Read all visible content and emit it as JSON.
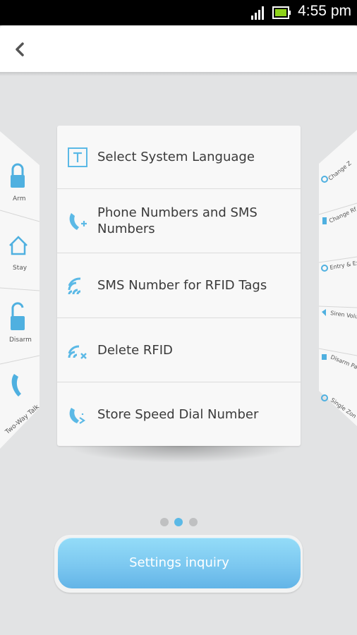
{
  "status_bar": {
    "time": "4:55 pm"
  },
  "left_panel": {
    "items": [
      {
        "label": "Arm",
        "icon": "lock-closed-icon"
      },
      {
        "label": "Stay",
        "icon": "home-icon"
      },
      {
        "label": "Disarm",
        "icon": "lock-open-icon"
      },
      {
        "label": "Two-Way Talk",
        "icon": "phone-icon"
      }
    ]
  },
  "right_panel": {
    "items": [
      {
        "label": "Change Z",
        "icon": "circle-icon"
      },
      {
        "label": "Change Rf",
        "icon": "person-icon"
      },
      {
        "label": "Entry & Ex",
        "icon": "clock-icon"
      },
      {
        "label": "Siren Volu",
        "icon": "speaker-icon"
      },
      {
        "label": "Disarm Pa",
        "icon": "lock-icon"
      },
      {
        "label": "Single Zon",
        "icon": "circle-icon"
      }
    ]
  },
  "menu": {
    "items": [
      {
        "label": "Select System Language",
        "icon": "language-t-icon"
      },
      {
        "label": "Phone Numbers and SMS Numbers",
        "icon": "phone-add-icon"
      },
      {
        "label": "SMS Number for RFID Tags",
        "icon": "rfid-signal-icon"
      },
      {
        "label": "Delete RFID",
        "icon": "rfid-delete-icon"
      },
      {
        "label": "Store Speed Dial Number",
        "icon": "speed-dial-icon"
      }
    ]
  },
  "pager": {
    "current_page": 2,
    "total_pages": 3
  },
  "actions": {
    "settings_inquiry": "Settings inquiry"
  },
  "colors": {
    "accent": "#5bb9e6",
    "button_top": "#94dcf8",
    "button_bottom": "#63b4e7"
  }
}
